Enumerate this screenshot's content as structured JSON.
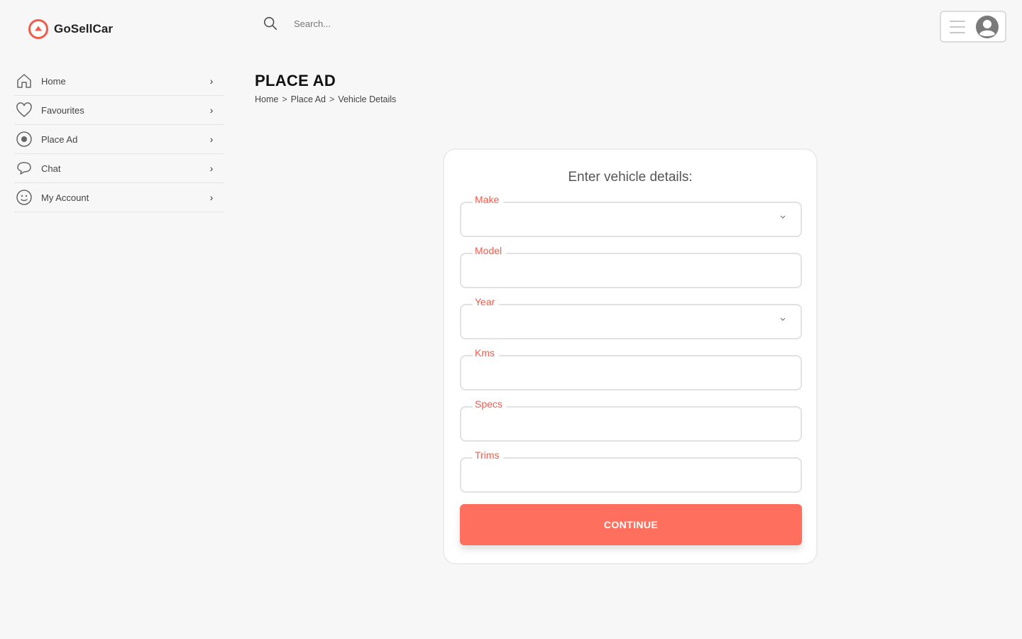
{
  "app": {
    "name": "GoSellCar"
  },
  "colors": {
    "accent": "#f25a4a",
    "button": "#ff6f5e",
    "background": "#f7f7f7"
  },
  "search": {
    "placeholder": "Search..."
  },
  "sidebar": {
    "items": [
      {
        "label": "Home",
        "icon": "home-icon"
      },
      {
        "label": "Favourites",
        "icon": "heart-icon"
      },
      {
        "label": "Place Ad",
        "icon": "plus-circle-icon"
      },
      {
        "label": "Chat",
        "icon": "chat-bubble-icon"
      },
      {
        "label": "My Account",
        "icon": "user-circle-icon"
      }
    ],
    "chevron": "›"
  },
  "page": {
    "title": "PLACE AD",
    "breadcrumb": [
      "Home",
      "Place Ad",
      "Vehicle Details"
    ],
    "breadcrumb_separator": ">"
  },
  "form": {
    "title": "Enter vehicle details:",
    "fields": [
      {
        "label": "Make",
        "type": "select",
        "value": ""
      },
      {
        "label": "Model",
        "type": "text",
        "value": ""
      },
      {
        "label": "Year",
        "type": "select",
        "value": ""
      },
      {
        "label": "Kms",
        "type": "text",
        "value": ""
      },
      {
        "label": "Specs",
        "type": "text",
        "value": ""
      },
      {
        "label": "Trims",
        "type": "text",
        "value": ""
      }
    ],
    "submit_label": "CONTINUE"
  },
  "header": {
    "menu_icon": "hamburger-menu-icon",
    "avatar_icon": "user-avatar-icon"
  }
}
